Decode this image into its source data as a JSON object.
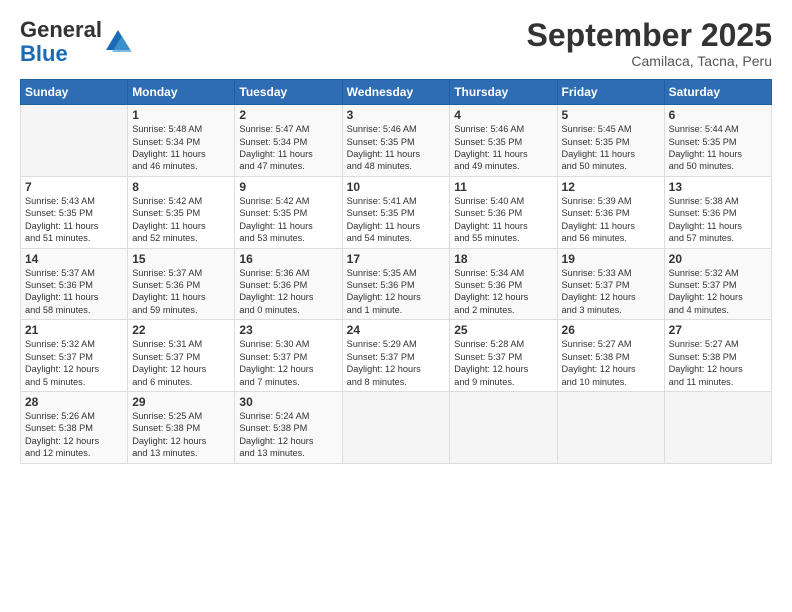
{
  "logo": {
    "general": "General",
    "blue": "Blue"
  },
  "title": "September 2025",
  "subtitle": "Camilaca, Tacna, Peru",
  "days": [
    "Sunday",
    "Monday",
    "Tuesday",
    "Wednesday",
    "Thursday",
    "Friday",
    "Saturday"
  ],
  "weeks": [
    [
      {
        "day": "",
        "text": ""
      },
      {
        "day": "1",
        "text": "Sunrise: 5:48 AM\nSunset: 5:34 PM\nDaylight: 11 hours\nand 46 minutes."
      },
      {
        "day": "2",
        "text": "Sunrise: 5:47 AM\nSunset: 5:34 PM\nDaylight: 11 hours\nand 47 minutes."
      },
      {
        "day": "3",
        "text": "Sunrise: 5:46 AM\nSunset: 5:35 PM\nDaylight: 11 hours\nand 48 minutes."
      },
      {
        "day": "4",
        "text": "Sunrise: 5:46 AM\nSunset: 5:35 PM\nDaylight: 11 hours\nand 49 minutes."
      },
      {
        "day": "5",
        "text": "Sunrise: 5:45 AM\nSunset: 5:35 PM\nDaylight: 11 hours\nand 50 minutes."
      },
      {
        "day": "6",
        "text": "Sunrise: 5:44 AM\nSunset: 5:35 PM\nDaylight: 11 hours\nand 50 minutes."
      }
    ],
    [
      {
        "day": "7",
        "text": "Sunrise: 5:43 AM\nSunset: 5:35 PM\nDaylight: 11 hours\nand 51 minutes."
      },
      {
        "day": "8",
        "text": "Sunrise: 5:42 AM\nSunset: 5:35 PM\nDaylight: 11 hours\nand 52 minutes."
      },
      {
        "day": "9",
        "text": "Sunrise: 5:42 AM\nSunset: 5:35 PM\nDaylight: 11 hours\nand 53 minutes."
      },
      {
        "day": "10",
        "text": "Sunrise: 5:41 AM\nSunset: 5:35 PM\nDaylight: 11 hours\nand 54 minutes."
      },
      {
        "day": "11",
        "text": "Sunrise: 5:40 AM\nSunset: 5:36 PM\nDaylight: 11 hours\nand 55 minutes."
      },
      {
        "day": "12",
        "text": "Sunrise: 5:39 AM\nSunset: 5:36 PM\nDaylight: 11 hours\nand 56 minutes."
      },
      {
        "day": "13",
        "text": "Sunrise: 5:38 AM\nSunset: 5:36 PM\nDaylight: 11 hours\nand 57 minutes."
      }
    ],
    [
      {
        "day": "14",
        "text": "Sunrise: 5:37 AM\nSunset: 5:36 PM\nDaylight: 11 hours\nand 58 minutes."
      },
      {
        "day": "15",
        "text": "Sunrise: 5:37 AM\nSunset: 5:36 PM\nDaylight: 11 hours\nand 59 minutes."
      },
      {
        "day": "16",
        "text": "Sunrise: 5:36 AM\nSunset: 5:36 PM\nDaylight: 12 hours\nand 0 minutes."
      },
      {
        "day": "17",
        "text": "Sunrise: 5:35 AM\nSunset: 5:36 PM\nDaylight: 12 hours\nand 1 minute."
      },
      {
        "day": "18",
        "text": "Sunrise: 5:34 AM\nSunset: 5:36 PM\nDaylight: 12 hours\nand 2 minutes."
      },
      {
        "day": "19",
        "text": "Sunrise: 5:33 AM\nSunset: 5:37 PM\nDaylight: 12 hours\nand 3 minutes."
      },
      {
        "day": "20",
        "text": "Sunrise: 5:32 AM\nSunset: 5:37 PM\nDaylight: 12 hours\nand 4 minutes."
      }
    ],
    [
      {
        "day": "21",
        "text": "Sunrise: 5:32 AM\nSunset: 5:37 PM\nDaylight: 12 hours\nand 5 minutes."
      },
      {
        "day": "22",
        "text": "Sunrise: 5:31 AM\nSunset: 5:37 PM\nDaylight: 12 hours\nand 6 minutes."
      },
      {
        "day": "23",
        "text": "Sunrise: 5:30 AM\nSunset: 5:37 PM\nDaylight: 12 hours\nand 7 minutes."
      },
      {
        "day": "24",
        "text": "Sunrise: 5:29 AM\nSunset: 5:37 PM\nDaylight: 12 hours\nand 8 minutes."
      },
      {
        "day": "25",
        "text": "Sunrise: 5:28 AM\nSunset: 5:37 PM\nDaylight: 12 hours\nand 9 minutes."
      },
      {
        "day": "26",
        "text": "Sunrise: 5:27 AM\nSunset: 5:38 PM\nDaylight: 12 hours\nand 10 minutes."
      },
      {
        "day": "27",
        "text": "Sunrise: 5:27 AM\nSunset: 5:38 PM\nDaylight: 12 hours\nand 11 minutes."
      }
    ],
    [
      {
        "day": "28",
        "text": "Sunrise: 5:26 AM\nSunset: 5:38 PM\nDaylight: 12 hours\nand 12 minutes."
      },
      {
        "day": "29",
        "text": "Sunrise: 5:25 AM\nSunset: 5:38 PM\nDaylight: 12 hours\nand 13 minutes."
      },
      {
        "day": "30",
        "text": "Sunrise: 5:24 AM\nSunset: 5:38 PM\nDaylight: 12 hours\nand 13 minutes."
      },
      {
        "day": "",
        "text": ""
      },
      {
        "day": "",
        "text": ""
      },
      {
        "day": "",
        "text": ""
      },
      {
        "day": "",
        "text": ""
      }
    ]
  ]
}
